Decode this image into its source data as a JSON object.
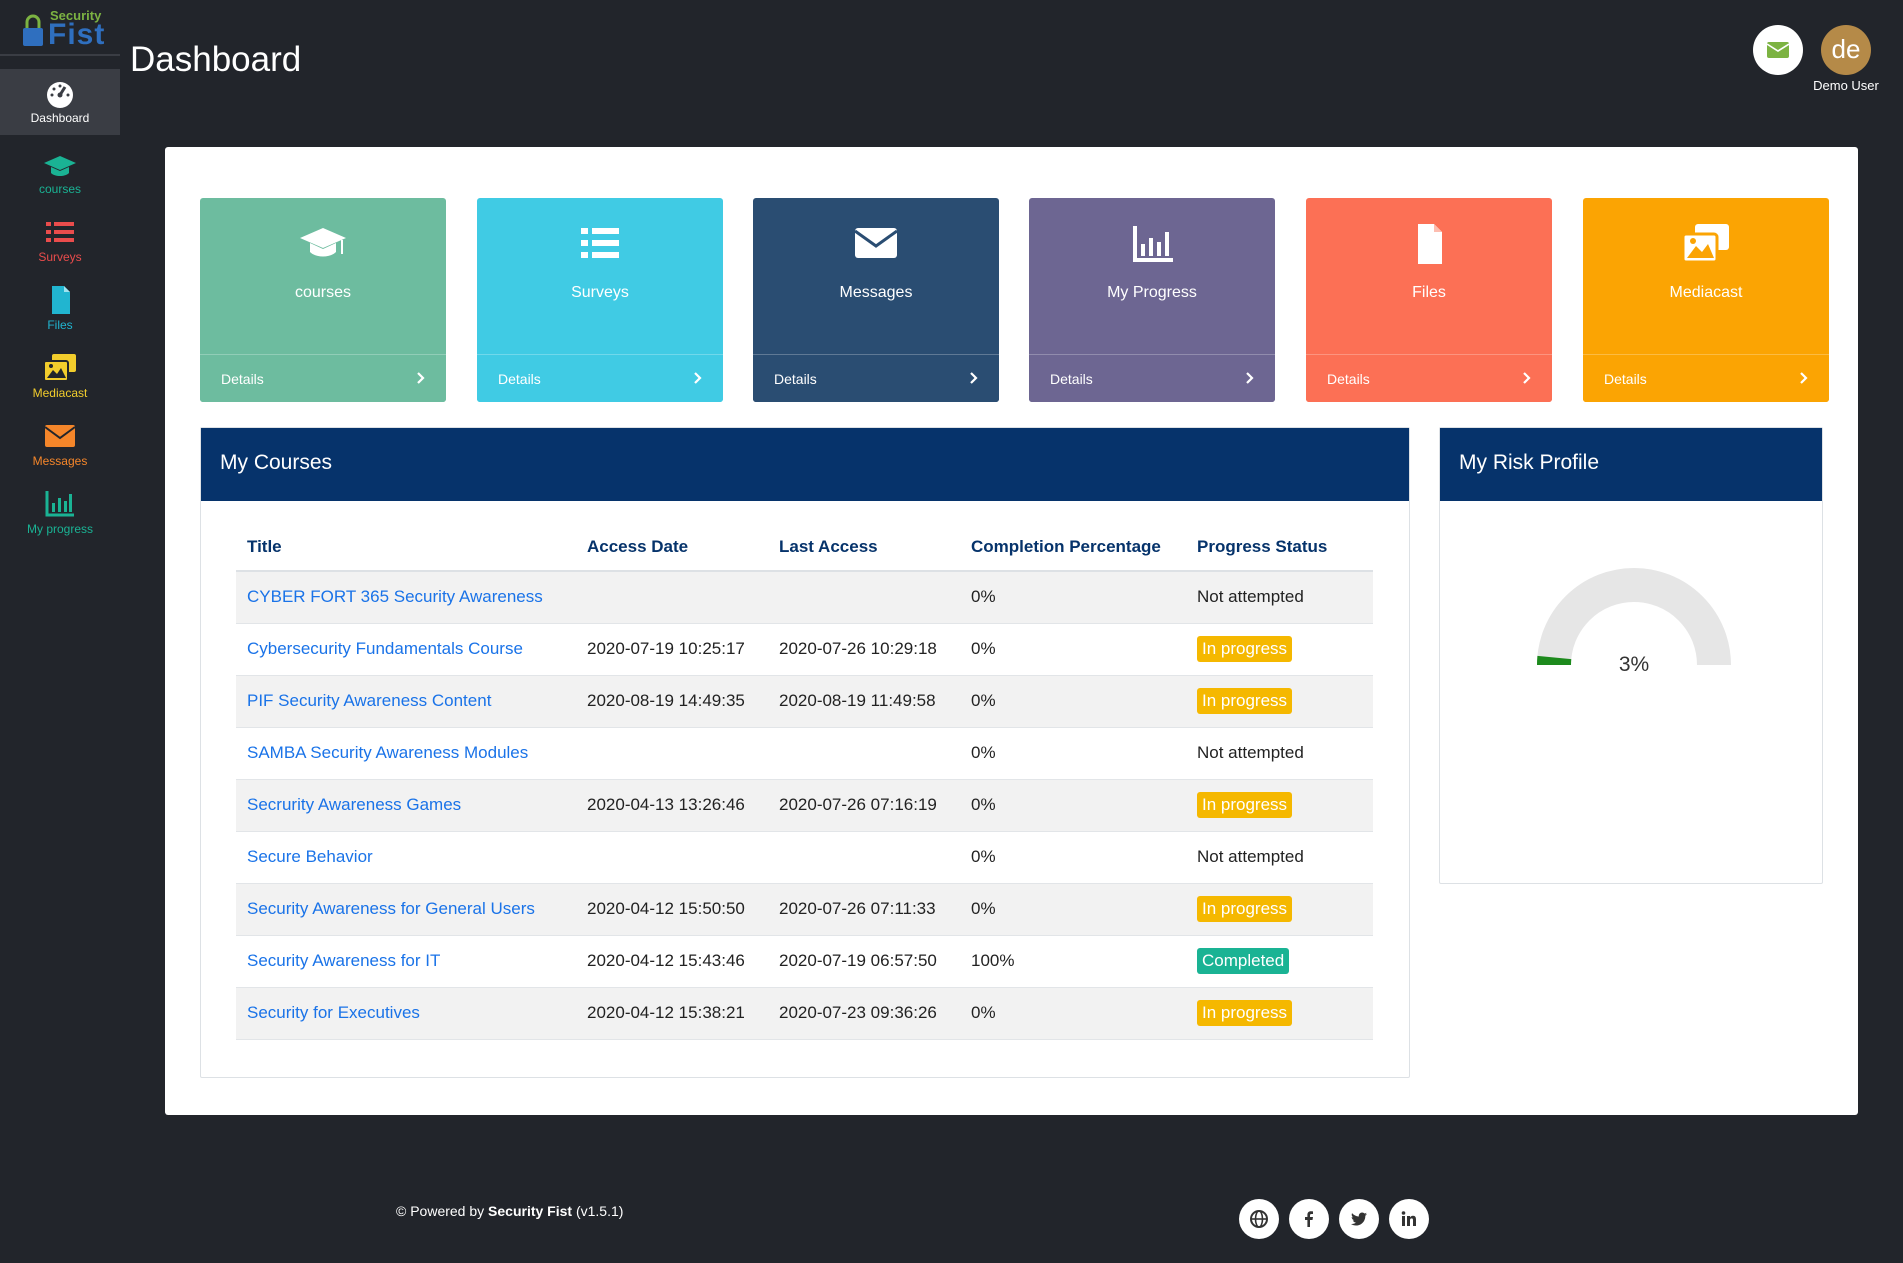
{
  "brand": {
    "top": "Security",
    "bottom": "Fist"
  },
  "header": {
    "title": "Dashboard",
    "user_initials": "de",
    "user_name": "Demo User"
  },
  "colors": {
    "background": "#22252b",
    "navy": "#06336b",
    "link": "#1a73e8",
    "in_progress": "#f5b800",
    "completed": "#1ab394"
  },
  "sidebar": {
    "items": [
      {
        "label": "Dashboard",
        "icon": "speedometer-icon",
        "color": "#ffffff"
      },
      {
        "label": "courses",
        "icon": "graduation-cap-icon",
        "color": "#1ab394"
      },
      {
        "label": "Surveys",
        "icon": "list-icon",
        "color": "#ea4c4c"
      },
      {
        "label": "Files",
        "icon": "file-icon",
        "color": "#21b5d0"
      },
      {
        "label": "Mediacast",
        "icon": "images-icon",
        "color": "#f2cd2c"
      },
      {
        "label": "Messages",
        "icon": "envelope-icon",
        "color": "#f5862a"
      },
      {
        "label": "My progress",
        "icon": "bar-chart-icon",
        "color": "#1ab394"
      }
    ]
  },
  "tiles": [
    {
      "title": "courses",
      "footer": "Details",
      "icon": "graduation-cap-icon",
      "color": "#6dbc9f"
    },
    {
      "title": "Surveys",
      "footer": "Details",
      "icon": "list-icon",
      "color": "#40cbe4"
    },
    {
      "title": "Messages",
      "footer": "Details",
      "icon": "envelope-icon",
      "color": "#2a4d72"
    },
    {
      "title": "My Progress",
      "footer": "Details",
      "icon": "bar-chart-icon",
      "color": "#6d6692"
    },
    {
      "title": "Files",
      "footer": "Details",
      "icon": "file-icon",
      "color": "#fc7055"
    },
    {
      "title": "Mediacast",
      "footer": "Details",
      "icon": "images-icon",
      "color": "#fba403"
    }
  ],
  "courses": {
    "title": "My Courses",
    "columns": [
      "Title",
      "Access Date",
      "Last Access",
      "Completion Percentage",
      "Progress Status"
    ],
    "rows": [
      {
        "title": "CYBER FORT 365 Security Awareness",
        "access": "",
        "last": "",
        "pct": "0%",
        "status": "Not attempted"
      },
      {
        "title": "Cybersecurity Fundamentals Course",
        "access": "2020-07-19 10:25:17",
        "last": "2020-07-26 10:29:18",
        "pct": "0%",
        "status": "In progress"
      },
      {
        "title": "PIF Security Awareness Content",
        "access": "2020-08-19 14:49:35",
        "last": "2020-08-19 11:49:58",
        "pct": "0%",
        "status": "In progress"
      },
      {
        "title": "SAMBA Security Awareness Modules",
        "access": "",
        "last": "",
        "pct": "0%",
        "status": "Not attempted"
      },
      {
        "title": "Secrurity Awareness Games",
        "access": "2020-04-13 13:26:46",
        "last": "2020-07-26 07:16:19",
        "pct": "0%",
        "status": "In progress"
      },
      {
        "title": "Secure Behavior",
        "access": "",
        "last": "",
        "pct": "0%",
        "status": "Not attempted"
      },
      {
        "title": "Security Awareness for General Users",
        "access": "2020-04-12 15:50:50",
        "last": "2020-07-26 07:11:33",
        "pct": "0%",
        "status": "In progress"
      },
      {
        "title": "Security Awareness for IT",
        "access": "2020-04-12 15:43:46",
        "last": "2020-07-19 06:57:50",
        "pct": "100%",
        "status": "Completed"
      },
      {
        "title": "Security for Executives",
        "access": "2020-04-12 15:38:21",
        "last": "2020-07-23 09:36:26",
        "pct": "0%",
        "status": "In progress"
      }
    ]
  },
  "risk": {
    "title": "My Risk Profile",
    "value": 3,
    "label": "3%",
    "track_color": "#e6e6e6",
    "fill_color": "#1d8a1d"
  },
  "footer": {
    "prefix": "© Powered by ",
    "brand": "Security Fist",
    "version": " (v1.5.1)"
  },
  "social": [
    "globe-icon",
    "facebook-icon",
    "twitter-icon",
    "linkedin-icon"
  ]
}
